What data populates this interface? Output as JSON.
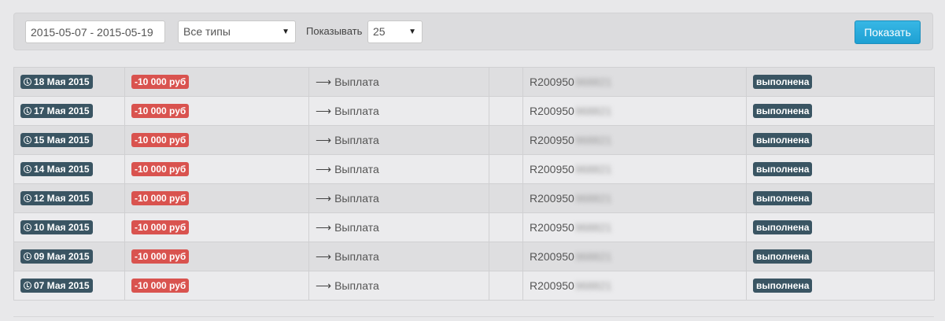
{
  "filters": {
    "date_range": "2015-05-07 - 2015-05-19",
    "type_select": "Все типы",
    "show_label": "Показывать",
    "count_select": "25",
    "submit_label": "Показать"
  },
  "operations": [
    {
      "date": "18 Мая 2015",
      "amount": "-10 000 руб",
      "type": "Выплата",
      "account": "R200950",
      "account_hidden": "968821",
      "status": "выполнена"
    },
    {
      "date": "17 Мая 2015",
      "amount": "-10 000 руб",
      "type": "Выплата",
      "account": "R200950",
      "account_hidden": "968821",
      "status": "выполнена"
    },
    {
      "date": "15 Мая 2015",
      "amount": "-10 000 руб",
      "type": "Выплата",
      "account": "R200950",
      "account_hidden": "968821",
      "status": "выполнена"
    },
    {
      "date": "14 Мая 2015",
      "amount": "-10 000 руб",
      "type": "Выплата",
      "account": "R200950",
      "account_hidden": "968821",
      "status": "выполнена"
    },
    {
      "date": "12 Мая 2015",
      "amount": "-10 000 руб",
      "type": "Выплата",
      "account": "R200950",
      "account_hidden": "968821",
      "status": "выполнена"
    },
    {
      "date": "10 Мая 2015",
      "amount": "-10 000 руб",
      "type": "Выплата",
      "account": "R200950",
      "account_hidden": "968821",
      "status": "выполнена"
    },
    {
      "date": "09 Мая 2015",
      "amount": "-10 000 руб",
      "type": "Выплата",
      "account": "R200950",
      "account_hidden": "968821",
      "status": "выполнена"
    },
    {
      "date": "07 Мая 2015",
      "amount": "-10 000 руб",
      "type": "Выплата",
      "account": "R200950",
      "account_hidden": "968821",
      "status": "выполнена"
    }
  ],
  "icons": {
    "date": "clock-icon",
    "type": "arrow-right-icon",
    "select": "caret-down-icon"
  },
  "colors": {
    "date_label": "#3a5563",
    "amount_label": "#d9534f",
    "status_label": "#3a5563",
    "button": "#1ea0d3"
  }
}
